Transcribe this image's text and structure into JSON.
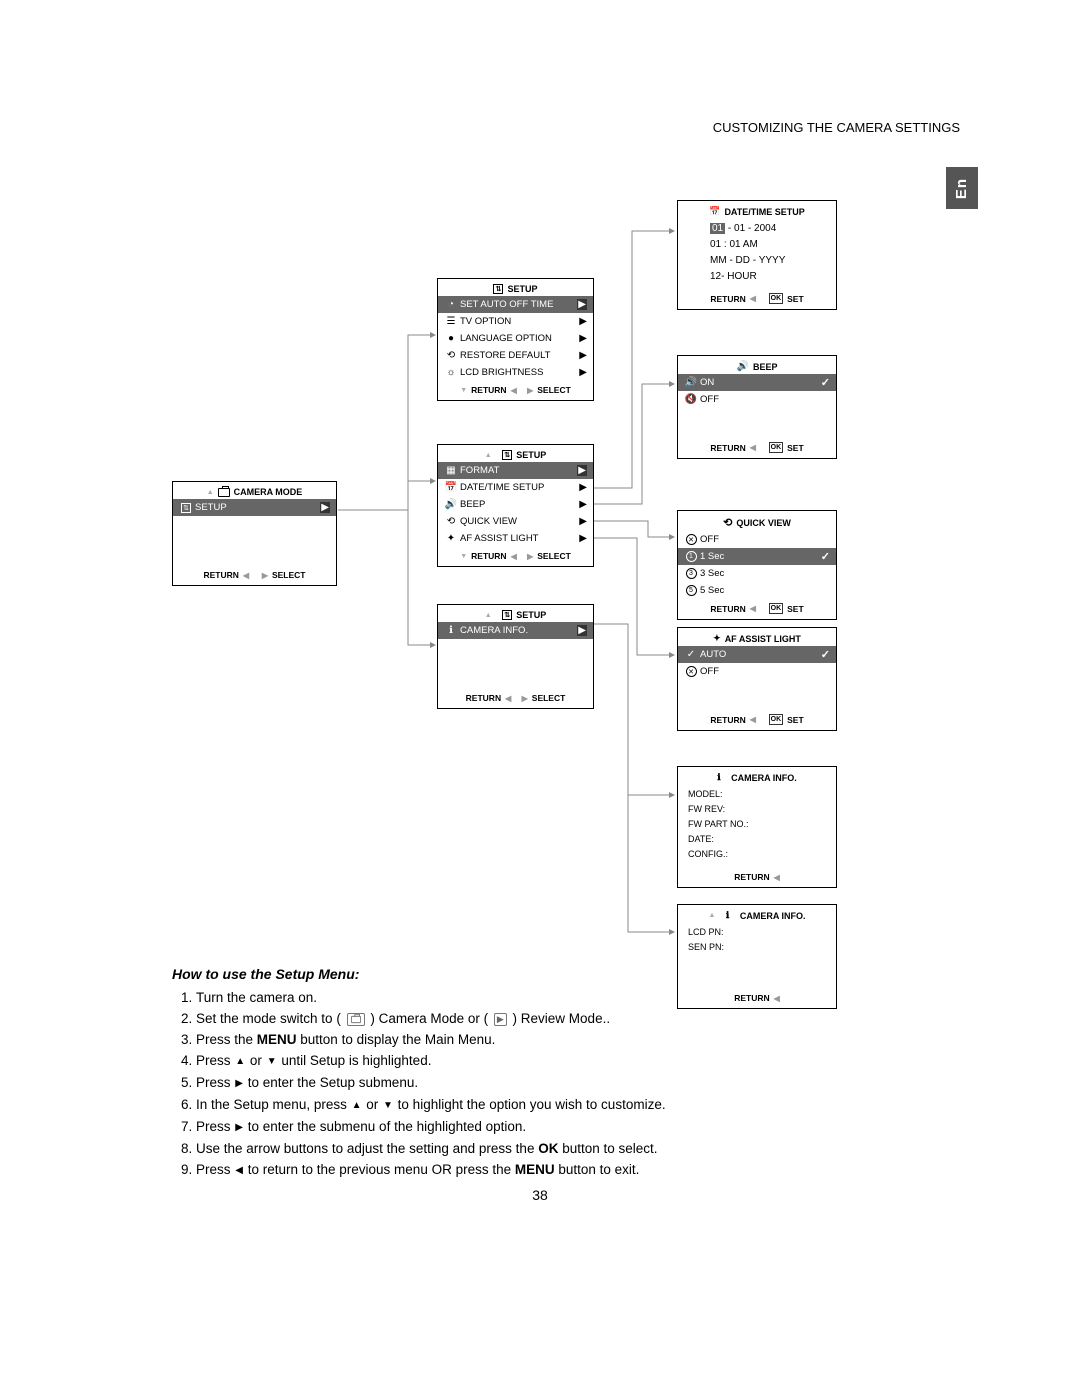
{
  "header": "CUSTOMIZING THE CAMERA SETTINGS",
  "lang_tab": "En",
  "page_number": "38",
  "camera_mode_panel": {
    "title": "CAMERA MODE",
    "setup_label": "SETUP",
    "footer_left": "RETURN",
    "footer_right": "SELECT"
  },
  "setup1": {
    "title": "SETUP",
    "items": [
      "SET AUTO OFF TIME",
      "TV OPTION",
      "LANGUAGE OPTION",
      "RESTORE DEFAULT",
      "LCD BRIGHTNESS"
    ],
    "footer_left": "RETURN",
    "footer_right": "SELECT"
  },
  "setup2": {
    "title": "SETUP",
    "items": [
      "FORMAT",
      "DATE/TIME SETUP",
      "BEEP",
      "QUICK VIEW",
      "AF ASSIST LIGHT"
    ],
    "footer_left": "RETURN",
    "footer_right": "SELECT"
  },
  "setup3": {
    "title": "SETUP",
    "item": "CAMERA INFO.",
    "footer_left": "RETURN",
    "footer_right": "SELECT"
  },
  "datetime": {
    "title": "DATE/TIME SETUP",
    "line1a": "01",
    "line1b": " - 01 - 2004",
    "line2": "01 : 01 AM",
    "line3": "MM - DD - YYYY",
    "line4": "12- HOUR",
    "footer_left": "RETURN",
    "footer_right": "SET"
  },
  "beep": {
    "title": "BEEP",
    "on": "ON",
    "off": "OFF",
    "footer_left": "RETURN",
    "footer_right": "SET"
  },
  "quickview": {
    "title": "QUICK VIEW",
    "items": [
      "OFF",
      "1 Sec",
      "3 Sec",
      "5 Sec"
    ],
    "footer_left": "RETURN",
    "footer_right": "SET"
  },
  "afassist": {
    "title": "AF ASSIST LIGHT",
    "auto": "AUTO",
    "off": "OFF",
    "footer_left": "RETURN",
    "footer_right": "SET"
  },
  "caminfo1": {
    "title": "CAMERA INFO.",
    "lines": [
      "MODEL:",
      "FW REV:",
      "FW PART NO.:",
      "DATE:",
      "CONFIG.:"
    ],
    "footer": "RETURN"
  },
  "caminfo2": {
    "title": "CAMERA INFO.",
    "lines": [
      "LCD PN:",
      "SEN PN:"
    ],
    "footer": "RETURN"
  },
  "howto": {
    "title": "How to use  the Setup Menu:",
    "s1": "Turn the camera on.",
    "s2a": "Set the mode switch to ( ",
    "s2b": " ) Camera Mode or ( ",
    "s2c": " ) Review Mode..",
    "s3a": "Press the ",
    "s3_menu": "MENU",
    "s3b": " button to display the Main Menu.",
    "s4a": "Press ",
    "s4b": " or ",
    "s4c": " until Setup is highlighted.",
    "s5a": "Press ",
    "s5b": " to enter the Setup submenu.",
    "s6a": "In the Setup menu, press ",
    "s6b": " or ",
    "s6c": " to highlight the option you wish to customize.",
    "s7a": "Press ",
    "s7b": " to enter the submenu of the highlighted option.",
    "s8a": "Use the arrow buttons to adjust the setting and press the ",
    "s8_ok": "OK",
    "s8b": " button to select.",
    "s9a": "Press ",
    "s9b": " to return to the previous menu OR press the ",
    "s9_menu": "MENU",
    "s9c": " button to exit."
  }
}
